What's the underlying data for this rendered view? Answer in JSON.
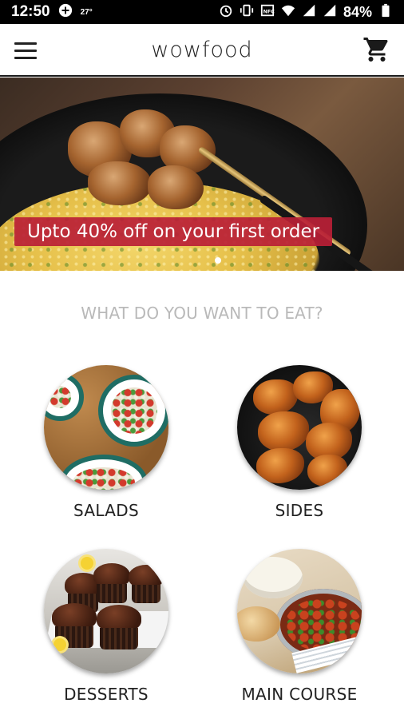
{
  "status_bar": {
    "time": "12:50",
    "temp_label": "27°",
    "battery_percent": "84%",
    "icons": [
      "gamepad-icon",
      "alarm-icon",
      "vibrate-icon",
      "nfc-icon",
      "wifi-icon",
      "signal-icon",
      "signal-icon",
      "battery-icon"
    ]
  },
  "app_bar": {
    "title": "wowfood",
    "menu_icon": "hamburger-menu-icon",
    "cart_icon": "shopping-cart-icon"
  },
  "banner": {
    "promo_text": "Upto 40% off on your first order",
    "active_slide_indicator": "dot"
  },
  "prompt": "WHAT DO YOU WANT TO EAT?",
  "categories": [
    {
      "label": "SALADS"
    },
    {
      "label": "SIDES"
    },
    {
      "label": "DESSERTS"
    },
    {
      "label": "MAIN COURSE"
    }
  ],
  "colors": {
    "promo_bg": "#ba2036",
    "prompt_text": "#b9b9b9",
    "app_bar_border": "#1a1a1a"
  }
}
